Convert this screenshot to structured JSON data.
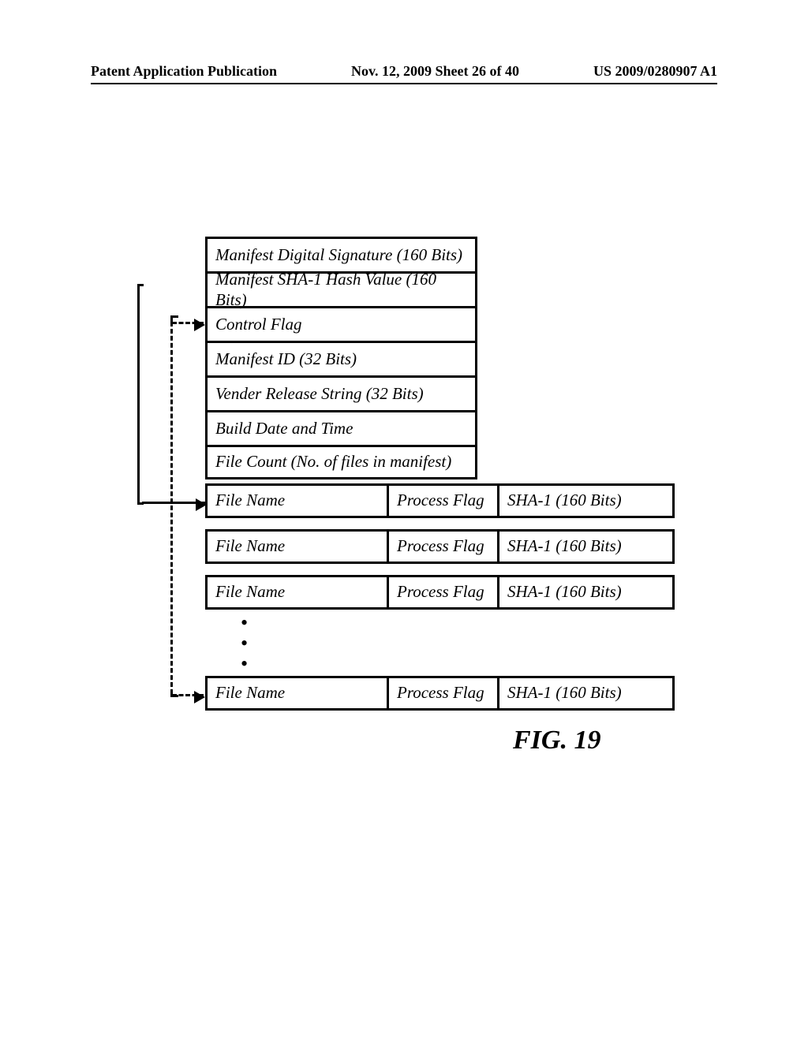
{
  "header": {
    "left": "Patent Application Publication",
    "center": "Nov. 12, 2009  Sheet 26 of 40",
    "right": "US 2009/0280907 A1"
  },
  "manifest": {
    "rows": [
      "Manifest Digital Signature (160 Bits)",
      "Manifest SHA-1 Hash Value (160 Bits)",
      "Control Flag",
      "Manifest ID (32 Bits)",
      "Vender Release String (32 Bits)",
      "Build Date and Time",
      "File Count (No. of files in manifest)"
    ],
    "file_entry": {
      "name": "File Name",
      "flag": "Process Flag",
      "hash": "SHA-1 (160 Bits)"
    }
  },
  "figure_label": "FIG. 19"
}
